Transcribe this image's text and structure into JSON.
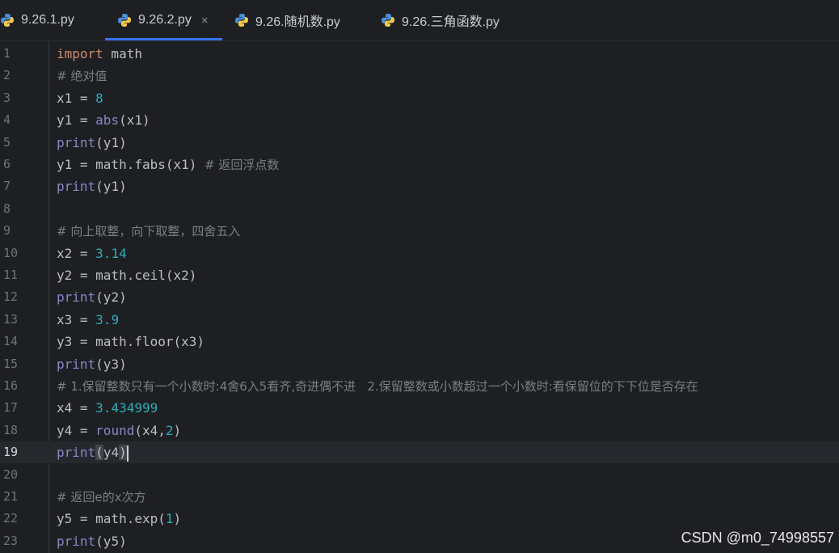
{
  "tabs": [
    {
      "label": "9.26.1.py",
      "active": false
    },
    {
      "label": "9.26.2.py",
      "active": true,
      "close": "×"
    },
    {
      "label": "9.26.随机数.py",
      "active": false
    },
    {
      "label": "9.26.三角函数.py",
      "active": false
    }
  ],
  "lines": [
    {
      "n": "1",
      "kw": "import",
      "rest": " math"
    },
    {
      "n": "2",
      "comment": "# 绝对值"
    },
    {
      "n": "3",
      "a": "x1 = ",
      "num": "8"
    },
    {
      "n": "4",
      "a": "y1 = ",
      "bi": "abs",
      "b": "(x1)"
    },
    {
      "n": "5",
      "bi": "print",
      "b": "(y1)"
    },
    {
      "n": "6",
      "a": "y1 = math.fabs(x1) ",
      "comment": "# 返回浮点数"
    },
    {
      "n": "7",
      "bi": "print",
      "b": "(y1)"
    },
    {
      "n": "8"
    },
    {
      "n": "9",
      "comment": "# 向上取整，向下取整，四舍五入"
    },
    {
      "n": "10",
      "a": "x2 = ",
      "num": "3.14"
    },
    {
      "n": "11",
      "a": "y2 = math.ceil(x2)"
    },
    {
      "n": "12",
      "bi": "print",
      "b": "(y2)"
    },
    {
      "n": "13",
      "a": "x3 = ",
      "num": "3.9"
    },
    {
      "n": "14",
      "a": "y3 = math.floor(x3)"
    },
    {
      "n": "15",
      "bi": "print",
      "b": "(y3)"
    },
    {
      "n": "16",
      "comment": "# 1.保留整数只有一个小数时:4舍6入5看齐,奇进偶不进   2.保留整数或小数超过一个小数时:看保留位的下下位是否存在"
    },
    {
      "n": "17",
      "a": "x4 = ",
      "num": "3.434999"
    },
    {
      "n": "18",
      "a": "y4 = ",
      "bi": "round",
      "b": "(x4,",
      "num2": "2",
      "c": ")"
    },
    {
      "n": "19",
      "bi": "print",
      "p1": "(",
      "mid": "y4",
      "p2": ")",
      "current": true
    },
    {
      "n": "20"
    },
    {
      "n": "21",
      "comment": "# 返回e的x次方"
    },
    {
      "n": "22",
      "a": "y5 = math.exp(",
      "num": "1",
      "c": ")"
    },
    {
      "n": "23",
      "bi": "print",
      "b": "(y5)"
    }
  ],
  "watermark": "CSDN @m0_74998557",
  "colors": {
    "accent": "#3574f0",
    "keyword": "#cf8e6d",
    "builtin": "#8888c6",
    "number": "#2aacb8",
    "comment": "#7a7e85"
  }
}
